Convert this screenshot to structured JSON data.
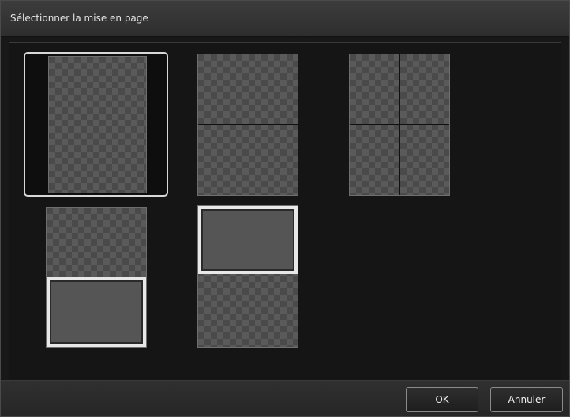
{
  "dialog": {
    "title": "Sélectionner la mise en page"
  },
  "layouts": [
    {
      "name": "single-photo",
      "selected": true
    },
    {
      "name": "two-photos-stacked",
      "selected": false
    },
    {
      "name": "four-photos-grid",
      "selected": false
    },
    {
      "name": "photo-with-bottom-frame",
      "selected": false
    },
    {
      "name": "photo-with-top-frame",
      "selected": false
    }
  ],
  "buttons": {
    "ok_label": "OK",
    "cancel_label": "Annuler"
  }
}
